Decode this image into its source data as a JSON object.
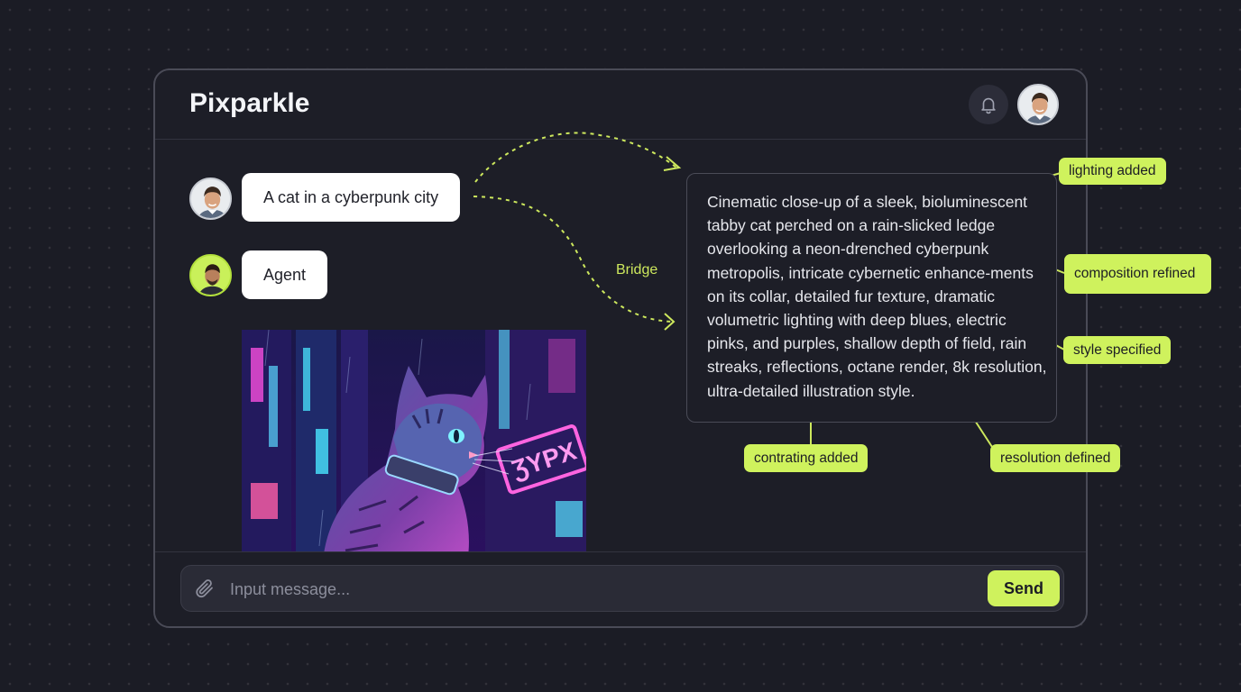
{
  "app": {
    "title": "Pixparkle"
  },
  "header": {
    "notification_icon": "bell-icon",
    "profile_avatar": "user-avatar"
  },
  "messages": [
    {
      "sender": "user",
      "avatar": "user-avatar",
      "text": "A cat in a cyberpunk city"
    },
    {
      "sender": "agent",
      "avatar": "agent-avatar",
      "text": "Agent"
    }
  ],
  "generated_image": {
    "subject": "neon cyberpunk tabby cat",
    "sign_text": "ƷYPX"
  },
  "composer": {
    "attach_icon": "paperclip-icon",
    "placeholder": "Input message...",
    "value": "",
    "send_label": "Send"
  },
  "bridge": {
    "label": "Bridge"
  },
  "enhanced_prompt": {
    "text": "Cinematic close-up of a sleek, bioluminescent tabby cat perched on a rain-slicked ledge overlooking a neon-drenched cyberpunk metropolis, intricate cybernetic enhance-ments on its collar, detailed fur texture, dramatic volumetric lighting with deep blues, electric pinks, and purples, shallow depth of field, rain streaks, reflections, octane render, 8k resolution, ultra-detailed illustration style."
  },
  "annotations": [
    {
      "label": "lighting added"
    },
    {
      "label": "composition refined"
    },
    {
      "label": "style specified"
    },
    {
      "label": "contrating added"
    },
    {
      "label": "resolution defined"
    }
  ],
  "colors": {
    "accent": "#cff25d",
    "background": "#1b1c25",
    "panel": "#1d1e27",
    "border": "#4a4b57"
  }
}
